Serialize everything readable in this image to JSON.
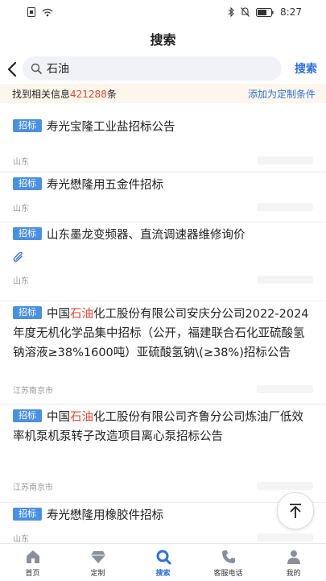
{
  "status_bar": {
    "time": "8:27"
  },
  "page_title": "搜索",
  "search": {
    "query": "石油",
    "button_label": "搜索"
  },
  "info_bar": {
    "prefix": "找到相关信息",
    "count": "421288",
    "suffix": "条",
    "add_condition": "添加为定制条件"
  },
  "results": [
    {
      "badge": "招标",
      "title_parts": [
        {
          "text": "寿光宝隆工业盐招标公告"
        }
      ],
      "region": "山东",
      "has_attachment": false
    },
    {
      "badge": "招标",
      "title_parts": [
        {
          "text": "寿光懋隆用五金件招标"
        }
      ],
      "region": "山东",
      "has_attachment": false
    },
    {
      "badge": "招标",
      "title_parts": [
        {
          "text": "山东墨龙变频器、直流调速器维修询价"
        }
      ],
      "region": "山东",
      "has_attachment": true
    },
    {
      "badge": "招标",
      "title_parts": [
        {
          "text": "中国"
        },
        {
          "text": "石油",
          "highlight": true
        },
        {
          "text": "化工股份有限公司安庆分公司2022-2024年度无机化学品集中招标（公开，福建联合石化亚硫酸氢钠溶液≥38%1600吨）亚硫酸氢钠\\(≥38%)招标公告"
        }
      ],
      "region": "江苏南京市",
      "has_attachment": false
    },
    {
      "badge": "招标",
      "title_parts": [
        {
          "text": "中国"
        },
        {
          "text": "石油",
          "highlight": true
        },
        {
          "text": "化工股份有限公司齐鲁分公司炼油厂低效率机泵机泵转子改造项目离心泵招标公告"
        }
      ],
      "region": "江苏南京市",
      "has_attachment": false
    },
    {
      "badge": "招标",
      "title_parts": [
        {
          "text": "寿光懋隆用橡胶件招标"
        }
      ],
      "region": "山东",
      "has_attachment": false
    }
  ],
  "tabs": [
    {
      "label": "首页",
      "icon": "home-icon"
    },
    {
      "label": "定制",
      "icon": "diamond-icon"
    },
    {
      "label": "搜索",
      "icon": "search-icon",
      "active": true
    },
    {
      "label": "客服电话",
      "icon": "phone-icon"
    },
    {
      "label": "我的",
      "icon": "user-icon"
    }
  ],
  "colors": {
    "accent": "#2f6fe0",
    "highlight": "#e0462f",
    "badge": "#4a90e2",
    "info_bg": "#fdf6ec"
  }
}
